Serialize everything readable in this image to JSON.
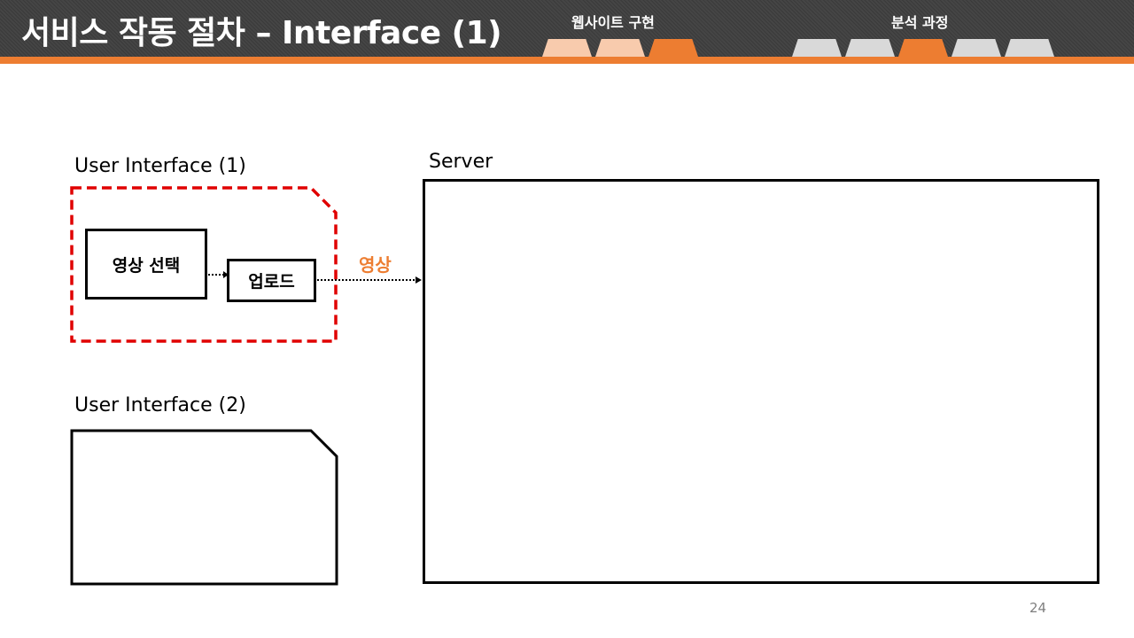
{
  "header": {
    "title": "서비스 작동 절차 – Interface (1)",
    "nav": [
      {
        "label": "웹사이트 구현",
        "tabs": 3,
        "active_tab": 3
      },
      {
        "label": "분석 과정",
        "tabs": 5,
        "active_tab": 3
      }
    ]
  },
  "diagram": {
    "ui1_label": "User Interface (1)",
    "ui2_label": "User Interface (2)",
    "server_label": "Server",
    "select_video": "영상 선택",
    "upload": "업로드",
    "arrow_label": "영상"
  },
  "colors": {
    "accent": "#ED7D31",
    "accent_light": "#F8CBAD",
    "dashed_border": "#E00000",
    "inactive_tab": "#D9D9D9"
  },
  "page_number": "24"
}
